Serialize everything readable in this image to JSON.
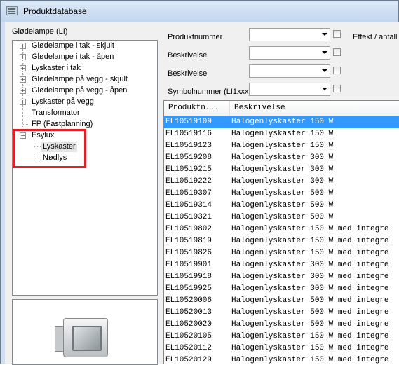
{
  "window": {
    "title": "Produktdatabase"
  },
  "left_panel": {
    "label": "Glødelampe (LI)",
    "tree": [
      {
        "label": "Glødelampe i tak - skjult",
        "expander": "+"
      },
      {
        "label": "Glødelampe i tak - åpen",
        "expander": "+"
      },
      {
        "label": "Lyskaster i tak",
        "expander": "+"
      },
      {
        "label": "Glødelampe på vegg - skjult",
        "expander": "+"
      },
      {
        "label": "Glødelampe på vegg - åpen",
        "expander": "+"
      },
      {
        "label": "Lyskaster på vegg",
        "expander": "+"
      },
      {
        "label": "Transformator",
        "expander": ""
      },
      {
        "label": "FP (Fastplanning)",
        "expander": ""
      },
      {
        "label": "Esylux",
        "expander": "−"
      },
      {
        "label": "Lyskaster",
        "expander": ""
      },
      {
        "label": "Nødlys",
        "expander": ""
      }
    ],
    "highlight_color": "#e21d24"
  },
  "filters": {
    "product_number_label": "Produktnummer",
    "description1_label": "Beskrivelse",
    "description2_label": "Beskrivelse",
    "symbol_label": "Symbolnummer (LI1xxx)",
    "effect_label": "Effekt / antall"
  },
  "list": {
    "columns": [
      "Produktn...",
      "Beskrivelse"
    ],
    "selected_color": "#3399ff",
    "rows": [
      [
        "EL10519109",
        "Halogenlyskaster 150 W"
      ],
      [
        "EL10519116",
        "Halogenlyskaster 150 W"
      ],
      [
        "EL10519123",
        "Halogenlyskaster 150 W"
      ],
      [
        "EL10519208",
        "Halogenlyskaster 300 W"
      ],
      [
        "EL10519215",
        "Halogenlyskaster 300 W"
      ],
      [
        "EL10519222",
        "Halogenlyskaster 300 W"
      ],
      [
        "EL10519307",
        "Halogenlyskaster 500 W"
      ],
      [
        "EL10519314",
        "Halogenlyskaster 500 W"
      ],
      [
        "EL10519321",
        "Halogenlyskaster 500 W"
      ],
      [
        "EL10519802",
        "Halogenlyskaster 150 W med integre"
      ],
      [
        "EL10519819",
        "Halogenlyskaster 150 W med integre"
      ],
      [
        "EL10519826",
        "Halogenlyskaster 150 W med integre"
      ],
      [
        "EL10519901",
        "Halogenlyskaster 300 W med integre"
      ],
      [
        "EL10519918",
        "Halogenlyskaster 300 W med integre"
      ],
      [
        "EL10519925",
        "Halogenlyskaster 300 W med integre"
      ],
      [
        "EL10520006",
        "Halogenlyskaster 500 W med integre"
      ],
      [
        "EL10520013",
        "Halogenlyskaster 500 W med integre"
      ],
      [
        "EL10520020",
        "Halogenlyskaster 500 W med integre"
      ],
      [
        "EL10520105",
        "Halogenlyskaster 150 W med integre"
      ],
      [
        "EL10520112",
        "Halogenlyskaster 150 W med integre"
      ],
      [
        "EL10520129",
        "Halogenlyskaster 150 W med integre"
      ],
      [
        "EL10520150",
        "Halogenlyskaster 300 W med integre"
      ]
    ]
  },
  "icons": {
    "app": "database-window-icon",
    "combo_arrow": "chevron-down-icon",
    "product_preview": "floodlight-product-image"
  }
}
